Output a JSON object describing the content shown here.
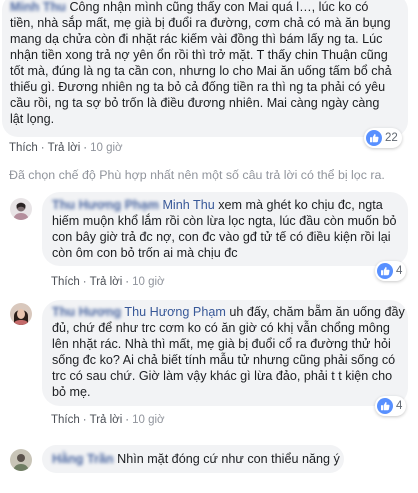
{
  "colors": {
    "bubble_bg": "#f2f3f5",
    "author_link": "#385898",
    "action_text": "#616770",
    "like_blue": "#5890ff"
  },
  "actions": {
    "like_label": "Thích",
    "reply_label": "Trả lời",
    "separator": "·"
  },
  "filter_notice": "Đã chọn chế độ Phù hợp nhất nên một số câu trả lời có thể bị lọc ra.",
  "comments": [
    {
      "author": "Minh Thu",
      "lines": [
        "Công nhận mình cũng thấy con Mai quá l…, lúc ko có",
        "tiền, nhà sắp mất, mẹ già bị đuổi ra đường, cơm chả có mà ăn bụng",
        "mang dạ chửa còn đi nhặt rác kiếm vài đồng thì bám lấy ng ta. Lúc",
        "nhận tiền xong trả nợ yên ổn rồi thì trở mặt. T thấy chin Thuận cũng",
        "tốt mà, đúng là ng ta cần con, nhưng lo cho Mai ăn uống tấm bổ chả",
        "thiếu gì. Đương nhiên ng ta bỏ cả đống tiền ra thì ng ta phải có yêu",
        "cầu rồi, ng ta sợ bỏ trốn là điều đương nhiên. Mai càng ngày càng",
        "lật lọng."
      ],
      "reaction_count": "22",
      "time": "10 giờ"
    },
    {
      "author": "Thu Hương Phạm",
      "mention": "Minh Thu",
      "lines": [
        "xem mà ghét ko chịu đc, ngta",
        "hiếm muộn khổ lắm rồi còn lừa lọc ngta, lúc đầu còn muốn bỏ",
        "con bây giờ trả đc nợ, con đc vào gđ tử tế có điều kiện rồi lại",
        "còn ôm con bỏ trốn ai mà chịu đc"
      ],
      "reaction_count": "4",
      "time": "10 giờ"
    },
    {
      "author": "Thu Hương",
      "mention": "Thu Hương Phạm",
      "lines": [
        "uh đấy, chăm bẵm ăn uống đầy",
        "đủ, chứ để như trc cơm ko có ăn giờ có khị vẫn chổng mông",
        "lên nhặt rác. Nhà thì mất, mẹ già bị đuổi cổ ra đường thử hỏi",
        "sống đc ko? Ai chả biết tính mẫu tử nhưng cũng phải sống có",
        "trc có sau chứ. Giờ làm vậy khác gì lừa đảo, phải t t kiện cho",
        "bỏ mẹ."
      ],
      "reaction_count": "4",
      "time": "10 giờ"
    },
    {
      "author": "Hằng Trần",
      "lines": [
        "Nhìn mặt đóng cứ như con thiểu năng ý"
      ]
    }
  ]
}
